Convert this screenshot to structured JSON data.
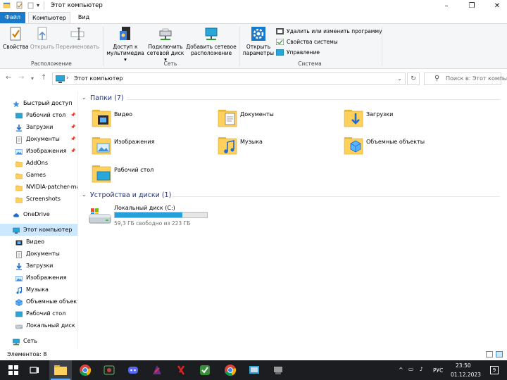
{
  "window": {
    "title": "Этот компьютер"
  },
  "ribbon": {
    "tabs": [
      "Файл",
      "Компьютер",
      "Вид"
    ],
    "buttons": {
      "properties": "Свойства",
      "open": "Открыть",
      "rename": "Переименовать",
      "media_access_l1": "Доступ к",
      "media_access_l2": "мультимедиа ▾",
      "map_drive_l1": "Подключить",
      "map_drive_l2": "сетевой диск ▾",
      "add_location_l1": "Добавить сетевое",
      "add_location_l2": "расположение",
      "open_settings_l1": "Открыть",
      "open_settings_l2": "параметры",
      "uninstall": "Удалить или изменить программу",
      "system_props": "Свойства системы",
      "manage": "Управление"
    },
    "groups": {
      "location": "Расположение",
      "network": "Сеть",
      "system": "Система"
    }
  },
  "address": {
    "path": "Этот компьютер",
    "search_placeholder": "Поиск в: Этот компьютер",
    "separator": "›"
  },
  "navpane": {
    "items": [
      {
        "label": "Быстрый доступ",
        "icon": "star-icon",
        "pinned": false
      },
      {
        "label": "Рабочий стол",
        "icon": "desktop-icon",
        "pinned": true
      },
      {
        "label": "Загрузки",
        "icon": "downloads-icon",
        "pinned": true
      },
      {
        "label": "Документы",
        "icon": "documents-icon",
        "pinned": true
      },
      {
        "label": "Изображения",
        "icon": "pictures-icon",
        "pinned": true
      },
      {
        "label": "AddOns",
        "icon": "folder-icon",
        "pinned": false
      },
      {
        "label": "Games",
        "icon": "folder-icon",
        "pinned": false
      },
      {
        "label": "NVIDIA-patcher-ma",
        "icon": "folder-icon",
        "pinned": false
      },
      {
        "label": "Screenshots",
        "icon": "folder-icon",
        "pinned": false
      },
      {
        "label": "OneDrive",
        "icon": "cloud-icon",
        "pinned": false
      },
      {
        "label": "Этот компьютер",
        "icon": "computer-icon",
        "pinned": false
      },
      {
        "label": "Видео",
        "icon": "video-icon",
        "pinned": false
      },
      {
        "label": "Документы",
        "icon": "documents-icon",
        "pinned": false
      },
      {
        "label": "Загрузки",
        "icon": "downloads-icon",
        "pinned": false
      },
      {
        "label": "Изображения",
        "icon": "pictures-icon",
        "pinned": false
      },
      {
        "label": "Музыка",
        "icon": "music-icon",
        "pinned": false
      },
      {
        "label": "Объемные объекты",
        "icon": "3d-objects-icon",
        "pinned": false
      },
      {
        "label": "Рабочий стол",
        "icon": "desktop-icon",
        "pinned": false
      },
      {
        "label": "Локальный диск (C",
        "icon": "drive-icon",
        "pinned": false
      },
      {
        "label": "Сеть",
        "icon": "network-icon",
        "pinned": false
      }
    ]
  },
  "folders_section": {
    "header": "Папки (7)",
    "items": [
      {
        "label": "Видео",
        "icon": "video-folder-icon"
      },
      {
        "label": "Документы",
        "icon": "documents-folder-icon"
      },
      {
        "label": "Загрузки",
        "icon": "downloads-folder-icon"
      },
      {
        "label": "Изображения",
        "icon": "pictures-folder-icon"
      },
      {
        "label": "Музыка",
        "icon": "music-folder-icon"
      },
      {
        "label": "Объемные объекты",
        "icon": "3d-objects-folder-icon"
      },
      {
        "label": "Рабочий стол",
        "icon": "desktop-folder-icon"
      }
    ]
  },
  "devices_section": {
    "header": "Устройства и диски (1)",
    "drive": {
      "name": "Локальный диск (C:)",
      "free_text": "59,3 ГБ свободно из 223 ГБ",
      "used_fraction": 0.734
    }
  },
  "status": {
    "items_count": "Элементов: 8"
  },
  "taskbar": {
    "lang": "РУС",
    "time": "23:50",
    "date": "01.12.2023",
    "notifications": "9"
  },
  "colors": {
    "accent": "#1979ca",
    "selection": "#cce8ff",
    "drive_fill": "#26a0da",
    "section_header": "#1e3287"
  }
}
